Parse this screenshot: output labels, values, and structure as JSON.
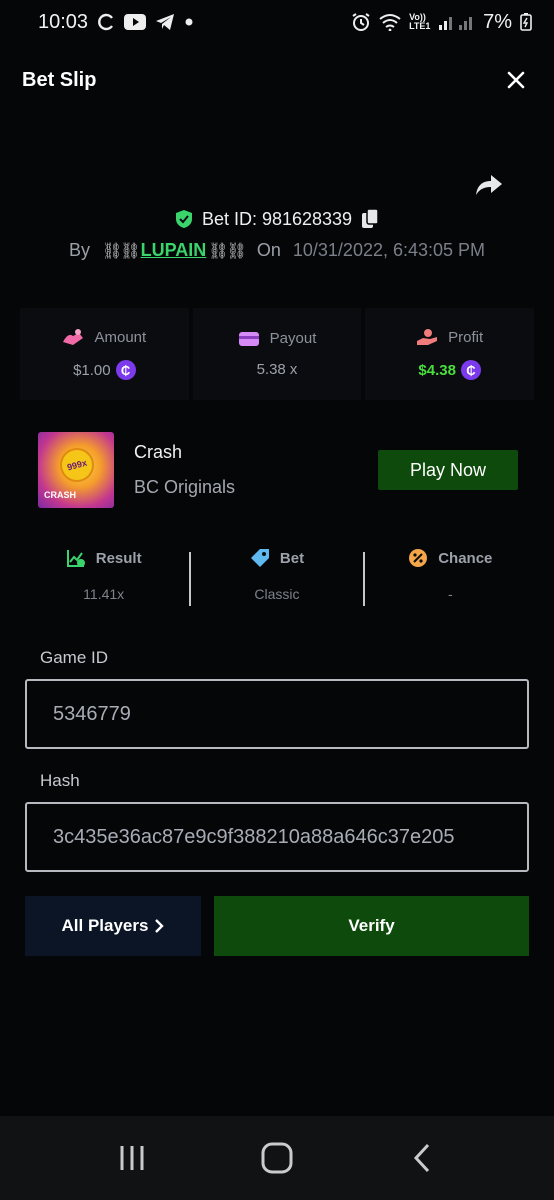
{
  "status_bar": {
    "time": "10:03",
    "battery": "7%",
    "network": "Vo)) LTE1"
  },
  "header": {
    "title": "Bet Slip"
  },
  "bet": {
    "id_label": "Bet ID: 981628339",
    "by_label": "By",
    "user": "LUPAIN",
    "on_label": "On",
    "date": "10/31/2022, 6:43:05 PM"
  },
  "stats": {
    "amount_label": "Amount",
    "amount_value": "$1.00",
    "payout_label": "Payout",
    "payout_value": "5.38 x",
    "profit_label": "Profit",
    "profit_value": "$4.38"
  },
  "game": {
    "thumb_badge": "999x",
    "thumb_text": "CRASH",
    "name": "Crash",
    "provider": "BC Originals",
    "play_label": "Play Now"
  },
  "results": {
    "result_label": "Result",
    "result_value": "11.41x",
    "bet_label": "Bet",
    "bet_value": "Classic",
    "chance_label": "Chance",
    "chance_value": "-"
  },
  "fields": {
    "game_id_label": "Game ID",
    "game_id_value": "5346779",
    "hash_label": "Hash",
    "hash_value": "3c435e36ac87e9c9f388210a88a646c37e205"
  },
  "actions": {
    "all_players_label": "All Players",
    "verify_label": "Verify"
  },
  "colors": {
    "accent_green": "#0d4a0b",
    "profit_green": "#4ade3c",
    "coin_purple": "#7c3aed"
  }
}
